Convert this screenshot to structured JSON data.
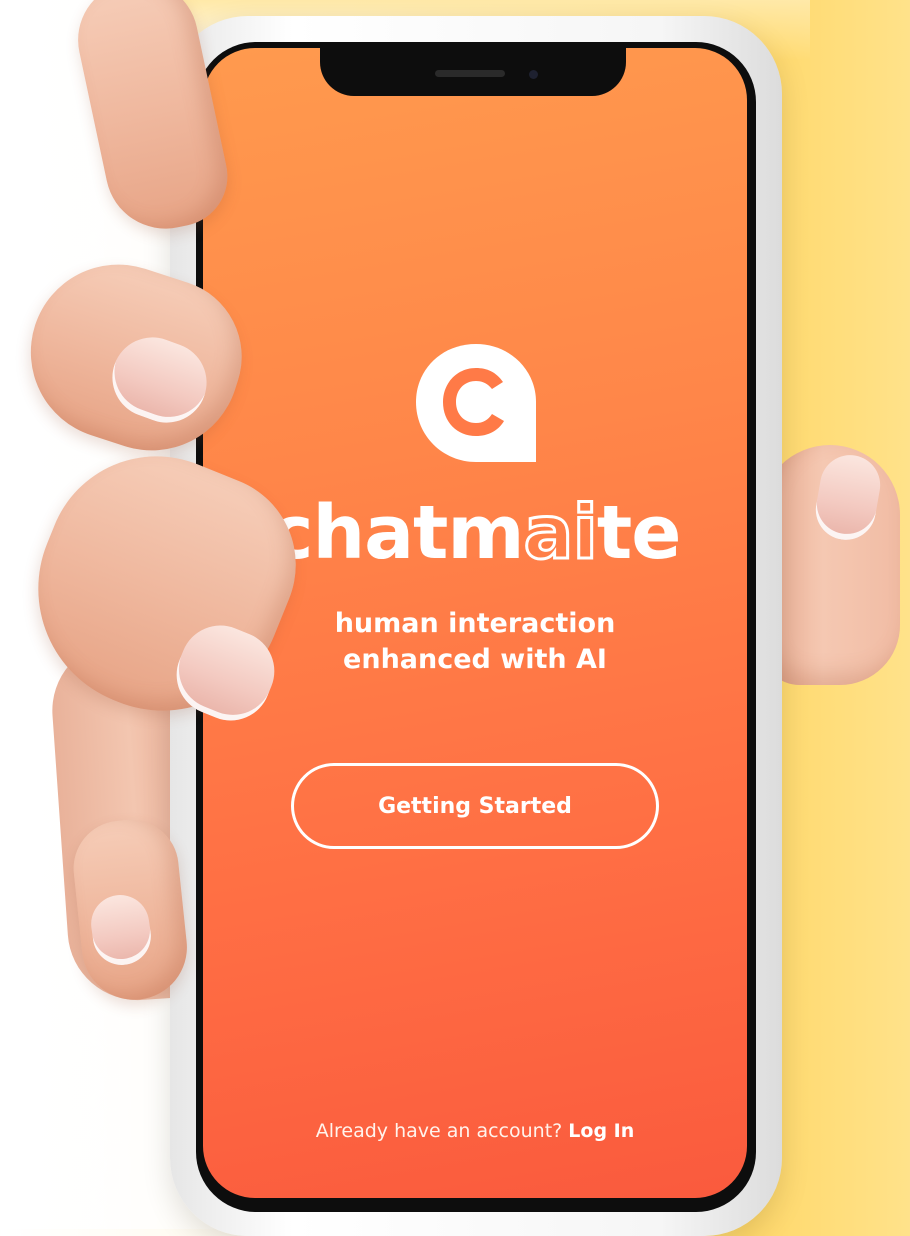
{
  "app": {
    "brand_prefix": "chatm",
    "brand_highlight_a": "a",
    "brand_highlight_i": "i",
    "brand_suffix": "te",
    "logo_letter": "c"
  },
  "tagline": {
    "line1": "human interaction",
    "line2": "enhanced with AI"
  },
  "cta": {
    "label": "Getting Started"
  },
  "footer": {
    "prompt": "Already have an account?",
    "login_label": "Log In"
  },
  "colors": {
    "gradient_top": "#ff9a4e",
    "gradient_bottom": "#fa5a3d",
    "text": "#ffffff",
    "background_yellow": "#ffd86a"
  },
  "icons": {
    "logo": "chat-bubble-c-icon"
  }
}
